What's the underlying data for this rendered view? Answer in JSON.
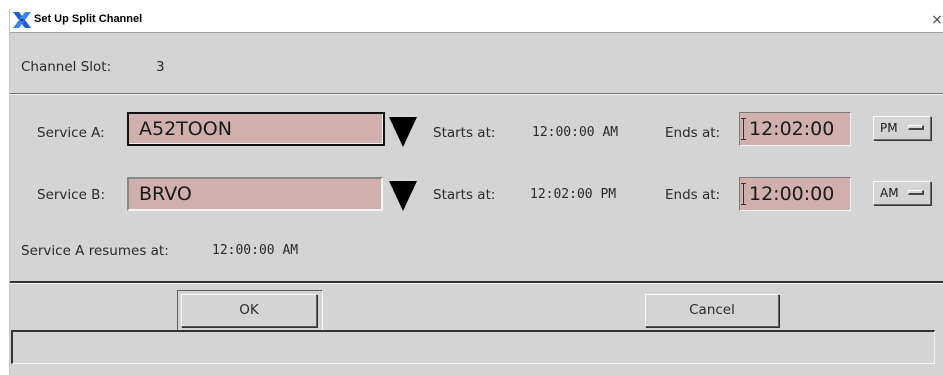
{
  "window": {
    "title": "Set Up Split Channel",
    "close_glyph": "×"
  },
  "channel_slot": {
    "label": "Channel Slot:",
    "value": "3"
  },
  "service_a": {
    "label": "Service A:",
    "value": "A52TOON",
    "starts_label": "Starts at:",
    "starts_value": "12:00:00 AM",
    "ends_label": "Ends at:",
    "ends_value": "12:02:00",
    "ampm": "PM"
  },
  "service_b": {
    "label": "Service B:",
    "value": "BRVO",
    "starts_label": "Starts at:",
    "starts_value": "12:02:00 PM",
    "ends_label": "Ends at:",
    "ends_value": "12:00:00",
    "ampm": "AM"
  },
  "resumes": {
    "label": "Service A resumes at:",
    "value": "12:00:00 AM"
  },
  "buttons": {
    "ok": "OK",
    "cancel": "Cancel"
  },
  "status_bar": {
    "text": ""
  },
  "colors": {
    "window_bg": "#d4d4d4",
    "field_bg": "#d1afae",
    "title_icon": "#1a5fd6"
  },
  "icons": {
    "title": "x-window-icon",
    "close": "close-icon",
    "dropdown": "triangle-down-icon"
  }
}
